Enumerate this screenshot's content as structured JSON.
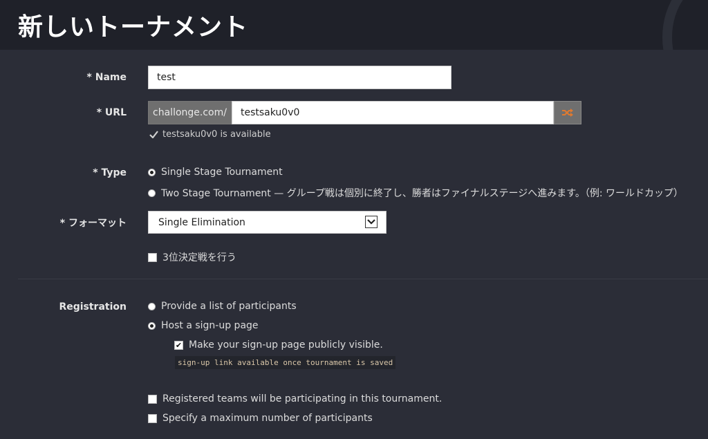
{
  "header": {
    "title": "新しいトーナメント"
  },
  "name": {
    "label": "* Name",
    "value": "test"
  },
  "url": {
    "label": "* URL",
    "prefix": "challonge.com/",
    "value": "testsaku0v0",
    "availability": "testsaku0v0 is available",
    "shuffle_icon": "shuffle-icon",
    "accent": "#e07a30"
  },
  "type": {
    "label": "* Type",
    "options": [
      {
        "label": "Single Stage Tournament",
        "selected": true
      },
      {
        "label": "Two Stage Tournament — グループ戦は個別に終了し、勝者はファイナルステージへ進みます。（例: ワールドカップ）",
        "selected": false
      }
    ]
  },
  "format": {
    "label": "* フォーマット",
    "selected": "Single Elimination",
    "third_place": "3位決定戦を行う"
  },
  "registration": {
    "label": "Registration",
    "options": [
      {
        "label": "Provide a list of participants",
        "selected": false
      },
      {
        "label": "Host a sign-up page",
        "selected": true
      }
    ],
    "public_visible": "Make your sign-up page publicly visible.",
    "signup_note": "sign-up link available once tournament is saved",
    "teams": "Registered teams will be participating in this tournament.",
    "max_participants": "Specify a maximum number of participants"
  }
}
